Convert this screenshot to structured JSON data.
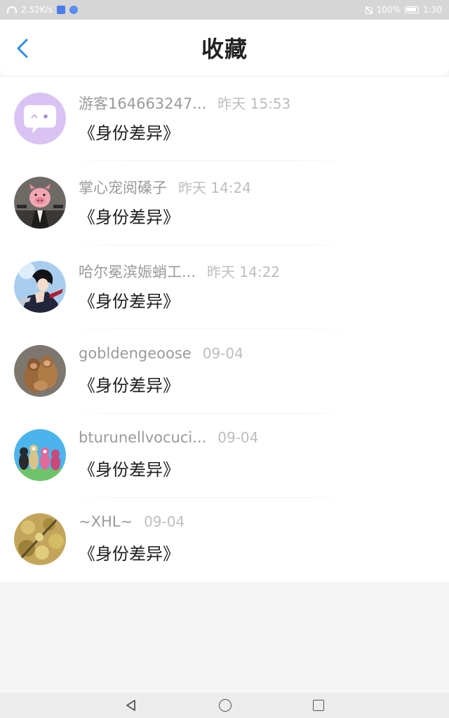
{
  "status_bar": {
    "speed": "2.52K/s",
    "battery": "100%",
    "time": "1:30"
  },
  "header": {
    "title": "收藏"
  },
  "items": [
    {
      "username": "游客164663247...",
      "time": "昨天 15:53",
      "book": "《身份差异》",
      "avatar": "chat-bubble-avatar"
    },
    {
      "username": "掌心宠阅磉子",
      "time": "昨天 14:24",
      "book": "《身份差异》",
      "avatar": "pig-suit-avatar"
    },
    {
      "username": "哈尔冕滨娠蛸工...",
      "time": "昨天 14:22",
      "book": "《身份差异》",
      "avatar": "anime-character-avatar"
    },
    {
      "username": "gobldengeoose",
      "time": "09-04",
      "book": "《身份差异》",
      "avatar": "monkeys-avatar"
    },
    {
      "username": "bturunellvocuci...",
      "time": "09-04",
      "book": "《身份差异》",
      "avatar": "cartoon-group-avatar"
    },
    {
      "username": "~XHL~",
      "time": "09-04",
      "book": "《身份差异》",
      "avatar": "autumn-leaves-avatar"
    }
  ],
  "colors": {
    "accent": "#2b8de8",
    "username": "#9a9a9a",
    "time": "#bdbdbd",
    "book": "#1d1d1d"
  }
}
